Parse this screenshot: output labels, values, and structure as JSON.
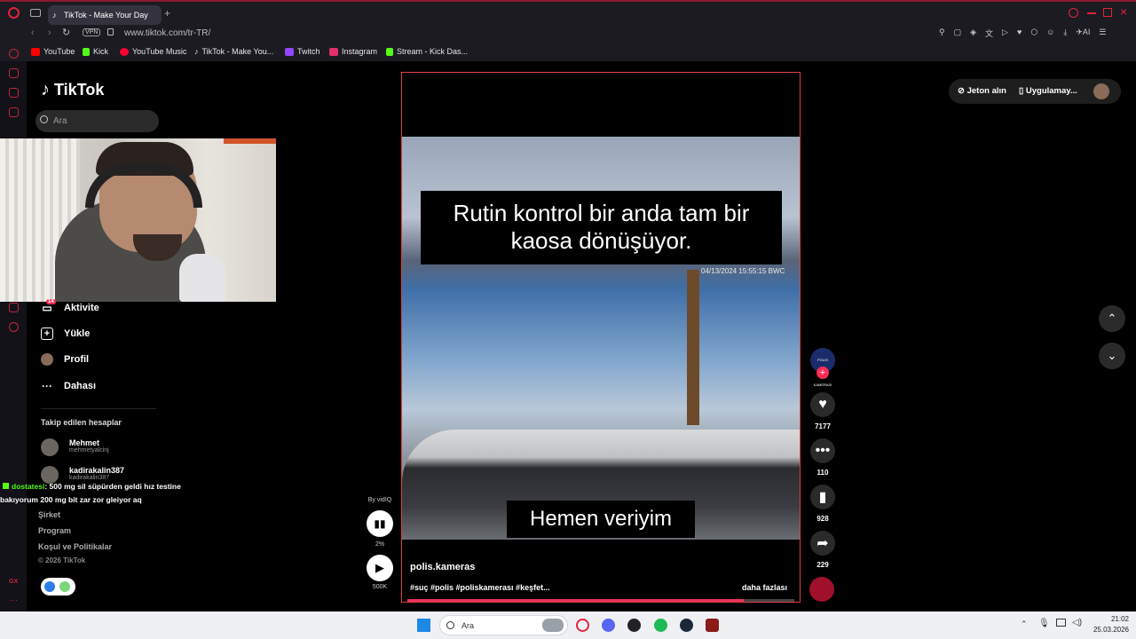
{
  "browser": {
    "tab_title": "TikTok - Make Your Day",
    "vpn_label": "VPN",
    "url": "www.tiktok.com/tr-TR/",
    "ai_label": "AI",
    "bookmarks": [
      {
        "label": "YouTube",
        "color": "#ff0000"
      },
      {
        "label": "Kick",
        "color": "#53fc18"
      },
      {
        "label": "YouTube Music",
        "color": "#ff0033"
      },
      {
        "label": "TikTok - Make You...",
        "color": "#ffffff"
      },
      {
        "label": "Twitch",
        "color": "#9146ff"
      },
      {
        "label": "Instagram",
        "color": "#e1306c"
      },
      {
        "label": "Stream - Kick Das...",
        "color": "#53fc18"
      }
    ]
  },
  "tiktok": {
    "logo": "TikTok",
    "search_placeholder": "Ara",
    "nav": {
      "activity": "Aktivite",
      "activity_badge": "14",
      "upload": "Yükle",
      "profile": "Profil",
      "more": "Dahası"
    },
    "following_title": "Takip edilen hesaplar",
    "following": [
      {
        "name": "Mehmet",
        "username": "mehmetyalcinj"
      },
      {
        "name": "kadirakalin387",
        "username": "kadirakalin387"
      }
    ],
    "footer": {
      "company": "Şirket",
      "program": "Program",
      "terms": "Koşul ve Politikalar",
      "copyright": "© 2026 TikTok"
    },
    "top_right": {
      "coins": "Jeton alın",
      "app": "Uygulamay..."
    }
  },
  "chat": {
    "user": "dostatesi",
    "message": ": 500 mg sil süpürden geldi hız testine bakıyorum 200 mg bit zar zor gleiyor aq"
  },
  "video": {
    "caption_top": "Rutin kontrol bir anda tam bir kaosa dönüşüyor.",
    "timestamp": "04/13/2024 15:55:15  BWC",
    "caption_bottom": "Hemen veriyim",
    "author": "polis.kameras",
    "hashtags": "#suç #polis #poliskamerası #keşfet...",
    "more": "daha fazlası",
    "progress": 0.87,
    "avatar_text": "POLIS KAMERASI"
  },
  "actions": {
    "likes": "7177",
    "comments": "110",
    "saves": "928",
    "shares": "229"
  },
  "vidiq": {
    "by": "By vidIQ",
    "percent": "2%",
    "views": "500K"
  },
  "taskbar": {
    "search": "Ara",
    "time": "21:02",
    "date": "25.03.2026"
  }
}
